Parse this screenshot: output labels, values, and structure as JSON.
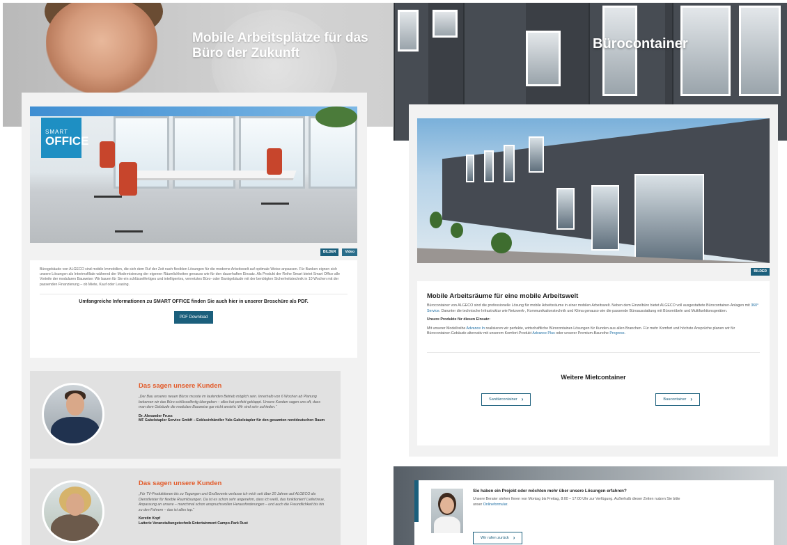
{
  "left": {
    "hero_title": "Mobile Arbeitsplätze für das Büro der Zukunft",
    "badge_top": "SMART",
    "badge_bottom": "OFFICE",
    "media_buttons": [
      "BILDER",
      "Video"
    ],
    "intro": "Bürogebäude von ALGECO sind mobile Immobilien, die sich dem Ruf der Zeit nach flexiblen Lösungen für die moderne Arbeitswelt auf optimale Weise anpassen. Für Banken eignen sich unsere Lösungen als Interimsfiliale während der Modernisierung der eigenen Räumlichkeiten genauso wie für den dauerhaften Einsatz. Als Produkt der Reihe Smart bietet Smart Office alle Vorteile der modularen Bauweise: Wir bauen für Sie ein schlüsselfertiges und intelligentes, vernetztes Büro- oder Bankgebäude mit der benötigten Sicherheitstechnik in 10 Wochen mit der passenden Finanzierung – ob Miete, Kauf oder Leasing.",
    "brochure_text": "Umfangreiche Informationen zu SMART OFFICE finden Sie auch hier in unserer Broschüre als PDF.",
    "pdf_button": "PDF Download",
    "testimonials": [
      {
        "heading": "Das sagen unsere Kunden",
        "quote": "„Der Bau unseres neuen Büros musste im laufenden Betrieb möglich sein. Innerhalb von 6 Wochen ab Planung bekamen wir das Büro schlüsselfertig übergeben – alles hat perfekt geklappt. Unsere Kunden sagen uns oft, dass man dem Gebäude die modulare Bauweise gar nicht ansieht. Wir sind sehr zufrieden.“",
        "author": "Dr. Alexander Fruss",
        "company": "MF Gabelstapler Service GmbH – Exklusivhändler Yale-Gabelstapler für den gesamten norddeutschen Raum"
      },
      {
        "heading": "Das sagen unsere Kunden",
        "quote": "„Für TV-Produktionen bis zu Tagungen und Großevents verlasse ich mich seit über 20 Jahren auf ALGECO als Dienstleister für flexible Raumlösungen. Da ist es schon sehr angenehm, dass ich weiß, das funktioniert! Liefertreue, Anpassung an unsere – manchmal schon anspruchsvollen Herausforderungen – und auch die Freundlichkeit bis hin zu den Fahrern – das ist alles top.“",
        "author": "Kerstin Kopf",
        "company": "Latterie Veranstaltungstechnik Entertainment Campo-Park Rust"
      }
    ]
  },
  "right": {
    "hero_title": "Bürocontainer",
    "bilder_button": "BILDER",
    "section_title": "Mobile Arbeitsräume für eine mobile Arbeitswelt",
    "para1_a": "Bürocontainer von ALGECO sind die professionelle Lösung für mobile Arbeitsräume in einer mobilen Arbeitswelt. Neben dem Einzelbüro bietet ALGECO voll ausgestattete Bürocontainer-Anlagen mit ",
    "para1_link": "360° Service",
    "para1_b": ". Darunter die technische Infrastruktur wie Netzwerk-, Kommunikationstechnik und Klima genauso wie die passende Büroausstattung mit Büromöbeln und Multifunktionsgeräten.",
    "products_label": "Unsere Produkte für diesen Einsatz:",
    "para2_a": "Mit unserer Modellreihe ",
    "para2_link1": "Advance In",
    "para2_b": " realisieren wir perfekte, wirtschaftliche Bürocontainer-Lösungen für Kunden aus allen Branchen. Für mehr Komfort und höchste Ansprüche planen wir für Bürocontainer-Gebäude alternativ mit unserem Komfort-Produkt ",
    "para2_link2": "Advance Plus",
    "para2_c": " oder unserer Premium-Baureihe ",
    "para2_link3": "Progress",
    "para2_d": ".",
    "more_title": "Weitere Mietcontainer",
    "buttons": [
      "Sanitärcontainer",
      "Baucontainer"
    ],
    "contact_question": "Sie haben ein Projekt oder möchten mehr über unsere Lösungen erfahren?",
    "contact_text_a": "Unsere Berater stehen Ihnen von Montag bis Freitag, 8:00 – 17:00 Uhr zur Verfügung. Außerhalb dieser Zeiten nutzen Sie bitte unser ",
    "contact_link": "Onlineformular",
    "contact_text_b": ".",
    "callback_button": "Wir rufen zurück"
  },
  "icons": {
    "chevron": "chevron-right-icon"
  },
  "colors": {
    "brand": "#1b5f7c",
    "accent": "#e25b2a",
    "badge": "#1e8fc3"
  }
}
